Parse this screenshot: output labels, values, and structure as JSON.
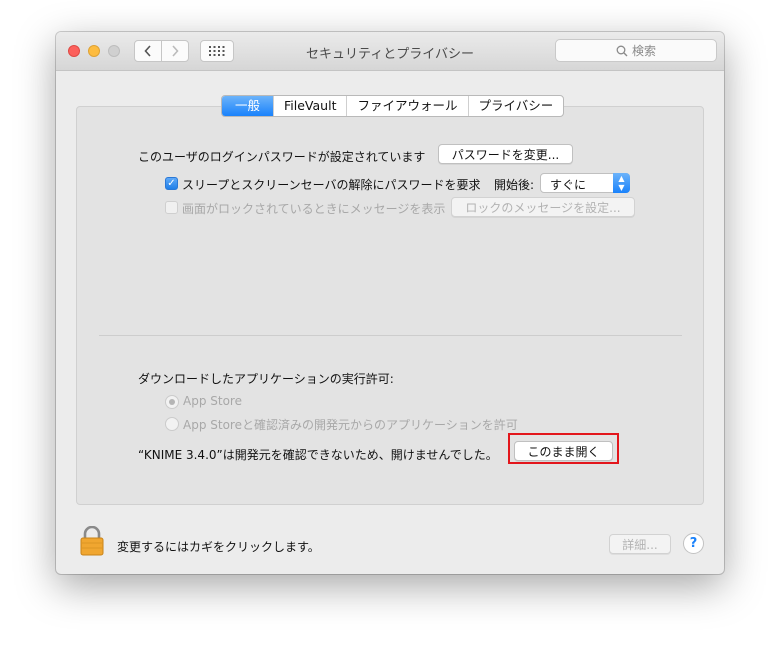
{
  "window": {
    "title": "セキュリティとプライバシー",
    "search_placeholder": "検索"
  },
  "tabs": [
    {
      "label": "一般",
      "active": true
    },
    {
      "label": "FileVault",
      "active": false
    },
    {
      "label": "ファイアウォール",
      "active": false
    },
    {
      "label": "プライバシー",
      "active": false
    }
  ],
  "general": {
    "password_text": "このユーザのログインパスワードが設定されています",
    "change_password_button": "パスワードを変更...",
    "require_password_label": "スリープとスクリーンセーバの解除にパスワードを要求",
    "require_password_checked": true,
    "start_label": "開始後:",
    "start_value": "すぐに",
    "lock_message_label": "画面がロックされているときにメッセージを表示",
    "lock_message_checked": false,
    "lock_message_button": "ロックのメッセージを設定..."
  },
  "downloads": {
    "heading": "ダウンロードしたアプリケーションの実行許可:",
    "options": [
      {
        "label": "App Store",
        "selected": true
      },
      {
        "label": "App Storeと確認済みの開発元からのアプリケーションを許可",
        "selected": false
      }
    ],
    "blocked_message": "“KNIME 3.4.0”は開発元を確認できないため、開けませんでした。",
    "open_anyway_button": "このまま開く"
  },
  "footer": {
    "lock_text": "変更するにはカギをクリックします。",
    "advanced_button": "詳細...",
    "help_symbol": "?"
  },
  "colors": {
    "accent": "#1a82fb",
    "highlight_border": "#e3161c",
    "lock": "#f0a630"
  }
}
